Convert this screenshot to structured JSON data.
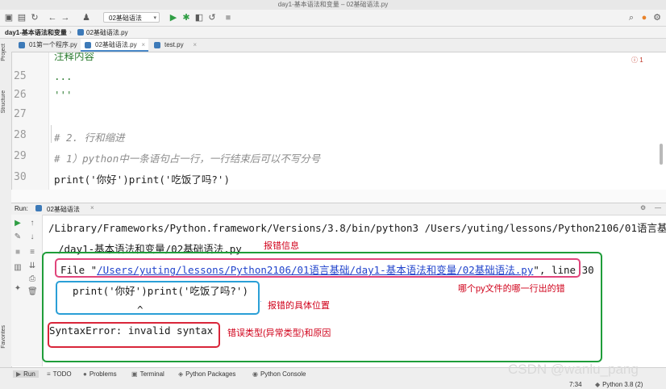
{
  "window": {
    "title": "day1-基本语法和变量 – 02基础语法.py"
  },
  "toolbar": {
    "run_config": "02基础语法"
  },
  "breadcrumbs": [
    "day1-基本语法和变量",
    "02基础语法.py"
  ],
  "tabs": [
    {
      "label": "01第一个程序.py"
    },
    {
      "label": "02基础语法.py",
      "active": true
    },
    {
      "label": "test.py"
    }
  ],
  "side_panels": {
    "project": "Project",
    "structure": "Structure",
    "favorites": "Favorites"
  },
  "editor": {
    "error_indicator": "1",
    "lines": [
      {
        "num": "",
        "text": "注释内容"
      },
      {
        "num": "25",
        "text": "..."
      },
      {
        "num": "26",
        "text": "'''"
      },
      {
        "num": "27",
        "text": ""
      },
      {
        "num": "28",
        "text": "# 2. 行和缩进"
      },
      {
        "num": "29",
        "text": "# 1）python中一条语句占一行，一行结束后可以不写分号"
      },
      {
        "num": "30",
        "text": "print('你好')print('吃饭了吗?')"
      }
    ]
  },
  "run_panel": {
    "label": "Run:",
    "tab": "02基础语法",
    "lines": {
      "cmd1": "/Library/Frameworks/Python.framework/Versions/3.8/bin/python3 /Users/yuting/lessons/Python2106/01语言基础",
      "cmd2": "/day1-基本语法和变量/02基础语法.py",
      "file_prefix": "File \"",
      "file_path": "/Users/yuting/lessons/Python2106/01语言基础/day1-基本语法和变量/02基础语法.py",
      "file_suffix": "\", line 30",
      "code": "print('你好')print('吃饭了吗?')",
      "caret": "^",
      "error": "SyntaxError: invalid syntax"
    }
  },
  "annotations": {
    "error_info": "报错信息",
    "which_line": "哪个py文件的哪一行出的错",
    "position": "报错的具体位置",
    "error_type": "错误类型(异常类型)和原因"
  },
  "statusbar": {
    "items": [
      "Run",
      "TODO",
      "Problems",
      "Terminal",
      "Python Packages",
      "Python Console"
    ],
    "time": "7:34",
    "interpreter": "Python 3.8 (2)"
  },
  "watermark": "CSDN @wanlu_pang",
  "colors": {
    "annotation_red": "#d0021b",
    "green_box": "#1f9d3a",
    "pink_box": "#e0457b",
    "blue_box": "#2a9fd6",
    "red_box": "#d9263a"
  }
}
